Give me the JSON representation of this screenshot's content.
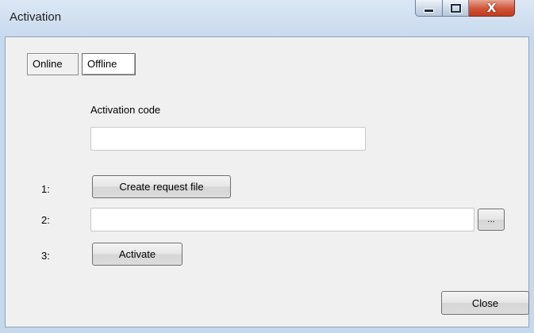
{
  "window": {
    "title": "Activation",
    "controls": {
      "minimize": "minimize",
      "maximize": "maximize",
      "close_glyph": "X"
    }
  },
  "tabs": [
    {
      "label": "Online",
      "selected": false
    },
    {
      "label": "Offline",
      "selected": true
    }
  ],
  "offline": {
    "activation_code_label": "Activation code",
    "activation_code_value": "",
    "steps": [
      {
        "number": "1:",
        "button_label": "Create request file"
      },
      {
        "number": "2:",
        "file_path_value": "",
        "browse_label": "..."
      },
      {
        "number": "3:",
        "button_label": "Activate"
      }
    ]
  },
  "footer": {
    "close_label": "Close"
  },
  "colors": {
    "titlebar": "#c9daee",
    "client_bg": "#f0f0f0",
    "close_button": "#c13b1d"
  }
}
